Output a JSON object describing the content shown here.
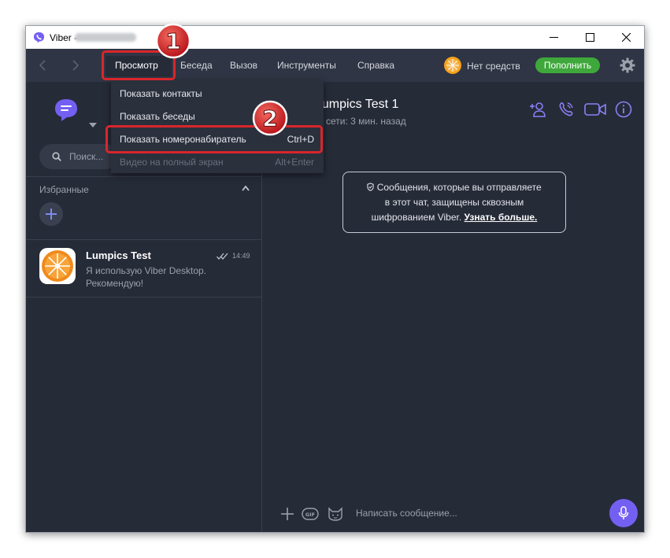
{
  "window": {
    "title": "Viber -"
  },
  "menubar": {
    "items": [
      "Просмотр",
      "Беседа",
      "Вызов",
      "Инструменты",
      "Справка"
    ],
    "balance": "Нет средств",
    "topup": "Пополнить"
  },
  "dropdown": {
    "items": [
      {
        "label": "Показать контакты",
        "shortcut": ""
      },
      {
        "label": "Показать беседы",
        "shortcut": ""
      },
      {
        "label": "Показать номеронабиратель",
        "shortcut": "Ctrl+D"
      },
      {
        "label": "Видео на полный экран",
        "shortcut": "Alt+Enter"
      }
    ]
  },
  "sidebar": {
    "search_placeholder": "Поиск...",
    "favorites_label": "Избранные",
    "chats": [
      {
        "name": "Lumpics Test",
        "time": "14:49",
        "message": "Я использую Viber Desktop. Рекомендую!"
      }
    ]
  },
  "chat": {
    "contact_name": "Lumpics Test 1",
    "status": "сети: 3 мин. назад",
    "e2e_line1": "Сообщения, которые вы отправляете",
    "e2e_line2": "в этот чат, защищены сквозным",
    "e2e_line3": "шифрованием Viber.",
    "e2e_link": "Узнать больше.",
    "composer_placeholder": "Написать сообщение..."
  },
  "annotations": {
    "badge1": "1",
    "badge2": "2"
  },
  "colors": {
    "accent": "#7360f2",
    "highlight": "#d8262b",
    "topup_green": "#3ea83b",
    "background": "#262b38"
  }
}
